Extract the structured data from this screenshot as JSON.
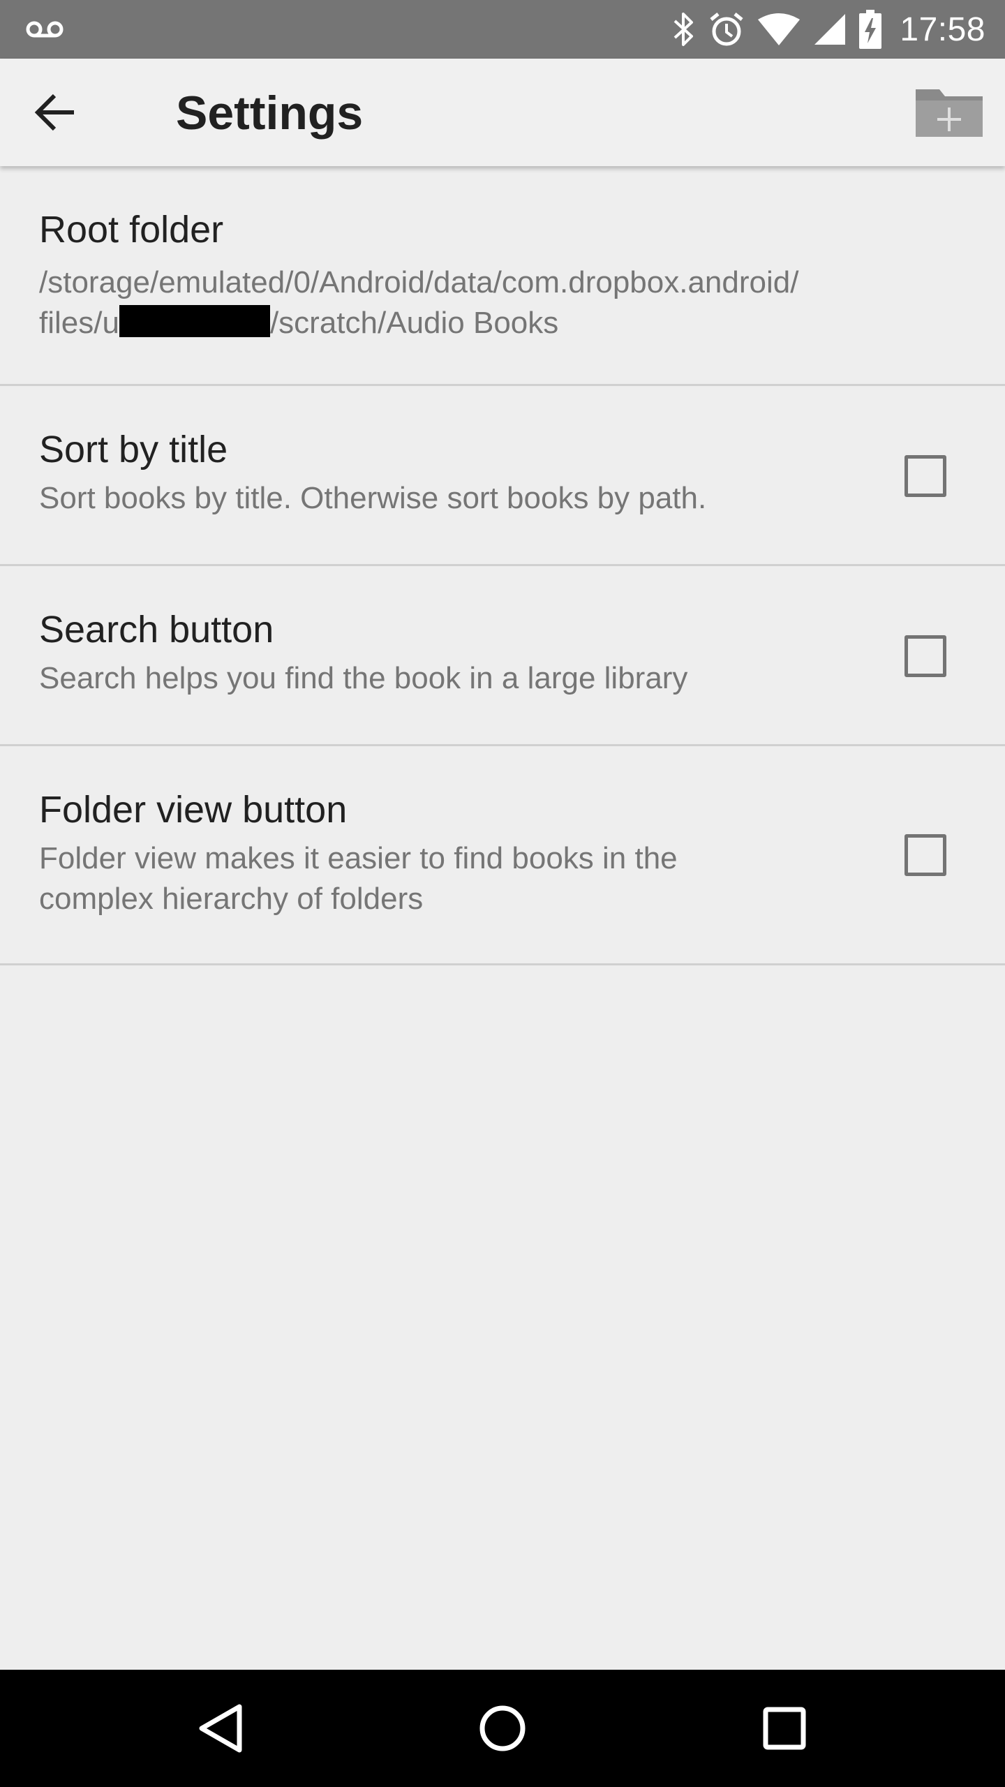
{
  "status_bar": {
    "time": "17:58",
    "icons": [
      "voicemail-icon",
      "bluetooth-icon",
      "alarm-icon",
      "wifi-icon",
      "cell-signal-icon",
      "battery-charging-icon"
    ]
  },
  "app_bar": {
    "title": "Settings",
    "back_icon": "arrow-back-icon",
    "action_icon": "folder-add-icon"
  },
  "preferences": [
    {
      "title": "Root folder",
      "summary_line1": "/storage/emulated/0/Android/data/com.dropbox.android/",
      "summary_line2_prefix": "files/u",
      "summary_line2_suffix": "/scratch/Audio Books"
    },
    {
      "title": "Sort by title",
      "summary_line1": "Sort books by title. Otherwise sort books by path.",
      "checked": false
    },
    {
      "title": "Search button",
      "summary_line1": "Search helps you find the book in a large library",
      "checked": false
    },
    {
      "title": "Folder view button",
      "summary_line1": "Folder view makes it easier to find books in the",
      "summary_line2": "complex hierarchy of folders",
      "checked": false
    }
  ],
  "nav_bar": {
    "icons": [
      "back-triangle-icon",
      "home-circle-icon",
      "recents-square-icon"
    ]
  },
  "colors": {
    "status_bar": "#757575",
    "app_bar": "#f0f0f0",
    "background": "#eeeeee",
    "title_text": "#212121",
    "summary_text": "#757575",
    "divider": "#d0d0d0",
    "nav_bar": "#000000"
  }
}
